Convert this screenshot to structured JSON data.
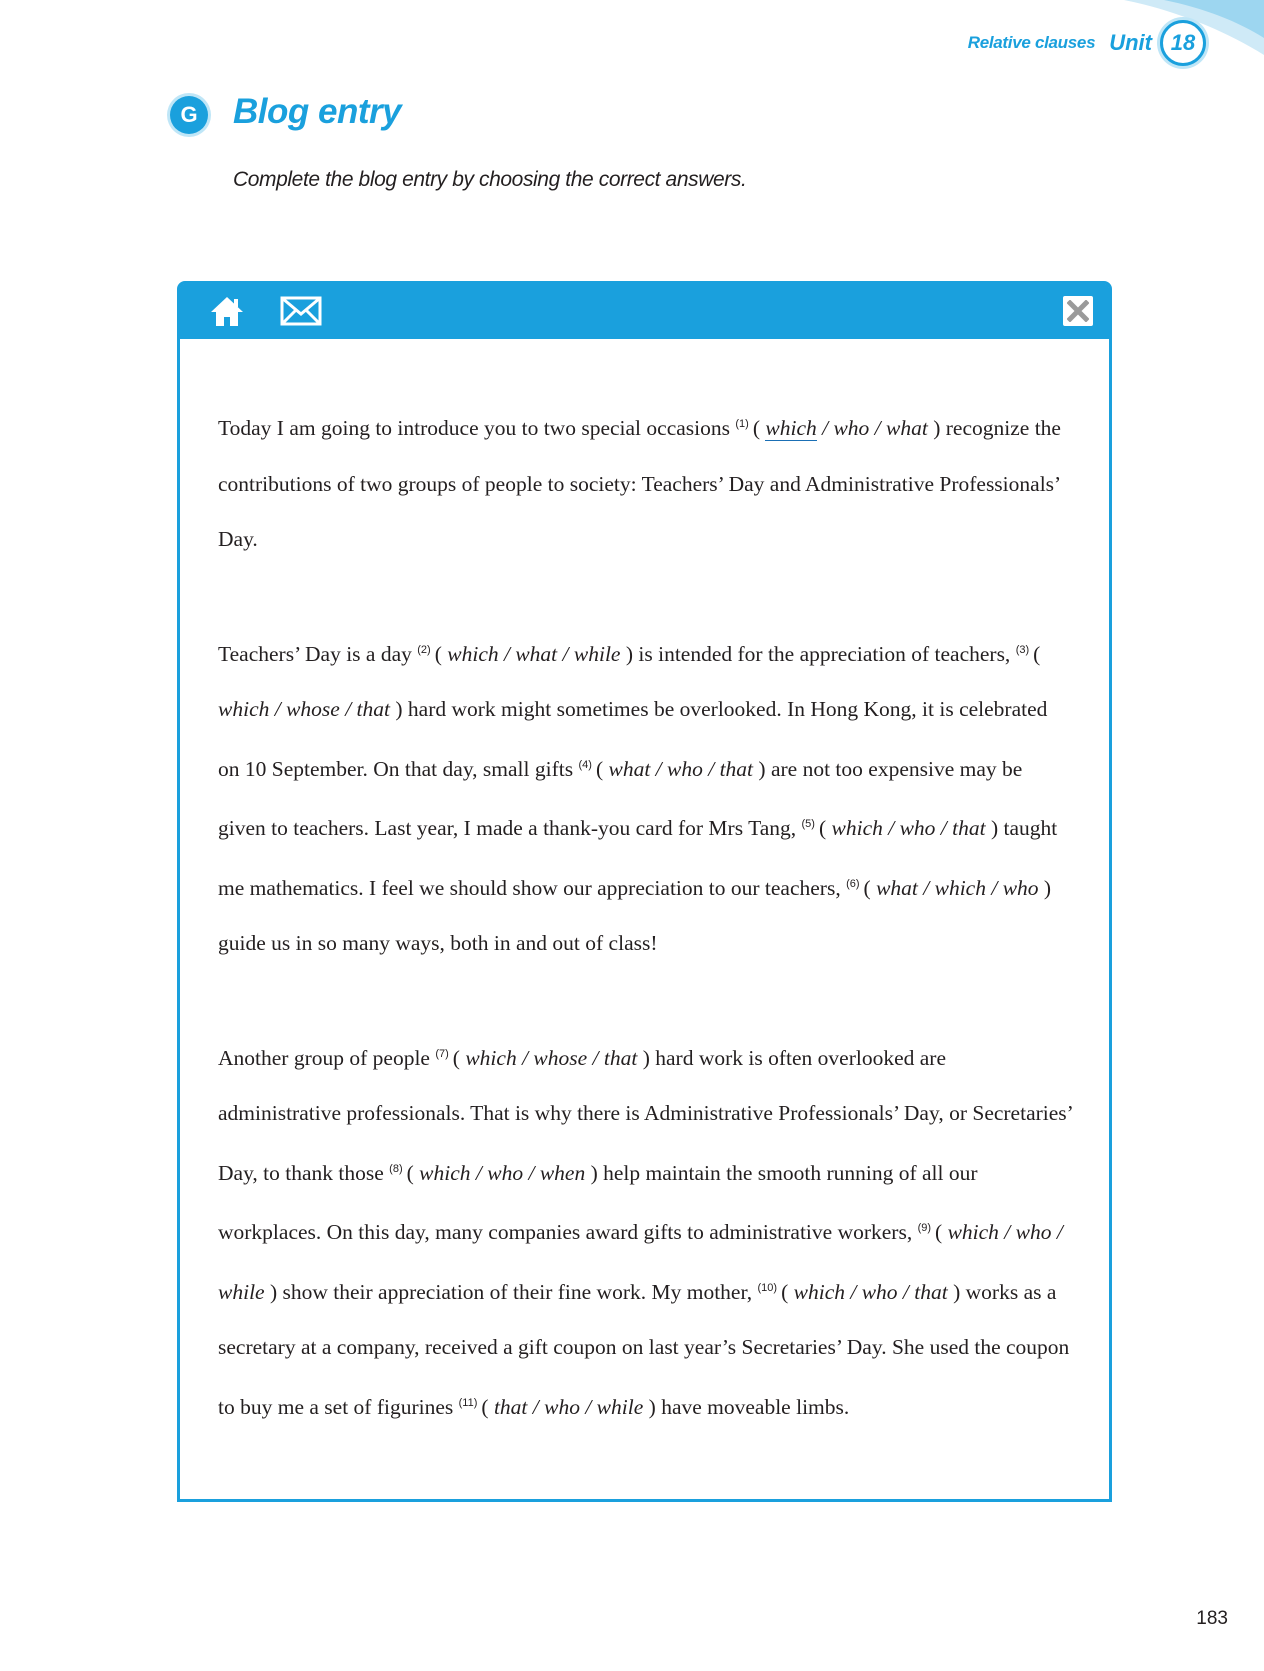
{
  "header": {
    "topic": "Relative clauses",
    "unit_label": "Unit",
    "unit_number": "18"
  },
  "section": {
    "letter": "G",
    "title": "Blog entry",
    "instruction": "Complete the blog entry by choosing the correct answers."
  },
  "toolbar": {
    "icons": [
      "home-icon",
      "mail-icon",
      "close-icon"
    ]
  },
  "blog": {
    "p1": {
      "t1": "Today I am going to introduce you to two special occasions ",
      "n1": "(1)",
      "o1a": "which",
      "o1b": " / who / what",
      "t2": " recognize the contributions of two groups of people to society: Teachers’ Day and Administrative Professionals’ Day."
    },
    "p2": {
      "t1": "Teachers’ Day is a day ",
      "n2": "(2)",
      "o2": " which / what / while ",
      "t2": " is intended for the appreciation of teachers, ",
      "n3": "(3)",
      "o3": " which / whose / that ",
      "t3": " hard work might sometimes be overlooked. In Hong Kong, it is celebrated on 10 September. On that day, small gifts ",
      "n4": "(4)",
      "o4": " what / who / that ",
      "t4": " are not too expensive may be given to teachers. Last year, I made a thank-you card for Mrs Tang, ",
      "n5": "(5)",
      "o5": " which / who / that ",
      "t5": " taught me mathematics. I feel we should show our appreciation to our teachers, ",
      "n6": "(6)",
      "o6": " what / which / who ",
      "t6": " guide us in so many ways, both in and out of class!"
    },
    "p3": {
      "t1": "Another group of people ",
      "n7": "(7)",
      "o7": " which / whose / that ",
      "t2": " hard work is often overlooked are administrative professionals. That is why there is Administrative Professionals’ Day, or Secretaries’ Day, to thank those ",
      "n8": "(8)",
      "o8": " which / who / when ",
      "t3": " help maintain the smooth running of all our workplaces. On this day, many companies award gifts to administrative workers, ",
      "n9": "(9)",
      "o9": " which / who / while ",
      "t4": " show their appreciation of their fine work. My mother, ",
      "n10": "(10)",
      "o10": " which / who / that ",
      "t5": " works as a secretary at a company, received a gift coupon on last year’s Secretaries’ Day. She used the coupon to buy me a set of figurines ",
      "n11": "(11)",
      "o11": " that / who / while ",
      "t6": " have moveable limbs."
    }
  },
  "page_number": "183"
}
